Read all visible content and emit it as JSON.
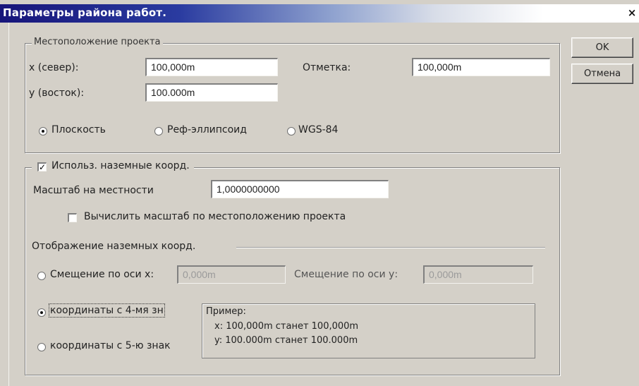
{
  "title": "Параметры района работ.",
  "buttons": {
    "ok": "OK",
    "cancel": "Отмена"
  },
  "location": {
    "legend": "Местоположение проекта",
    "x_label": "x (север):",
    "x_value": "100,000m",
    "elevation_label": "Отметка:",
    "elevation_value": "100,000m",
    "y_label": "у (восток):",
    "y_value": "100.000m",
    "radios": [
      "Плоскость",
      "Реф-эллипсоид",
      "WGS-84"
    ],
    "selected_radio": "Плоскость"
  },
  "ground": {
    "checkbox_label": "Использ. наземные коорд.",
    "checked": true,
    "scale_label": "Масштаб на местности",
    "scale_value": "1,0000000000",
    "compute_checkbox_label": "Вычислить масштаб по местоположению проекта",
    "compute_checked": false,
    "display_label": "Отображение наземных коорд.",
    "offset_x_label": "Смещение по оси х:",
    "offset_x_value": "0,000m",
    "offset_y_label": "Смещение по оси у:",
    "offset_y_value": "0,000m",
    "coords4_label": "координаты с 4-мя зн",
    "coords5_label": "координаты с 5-ю знак",
    "selected_display": "координаты с 4-мя зн",
    "example_title": "Пример:",
    "example_line1": "x: 100,000m станет 100,000m",
    "example_line2": "y: 100.000m станет 100.000m"
  }
}
